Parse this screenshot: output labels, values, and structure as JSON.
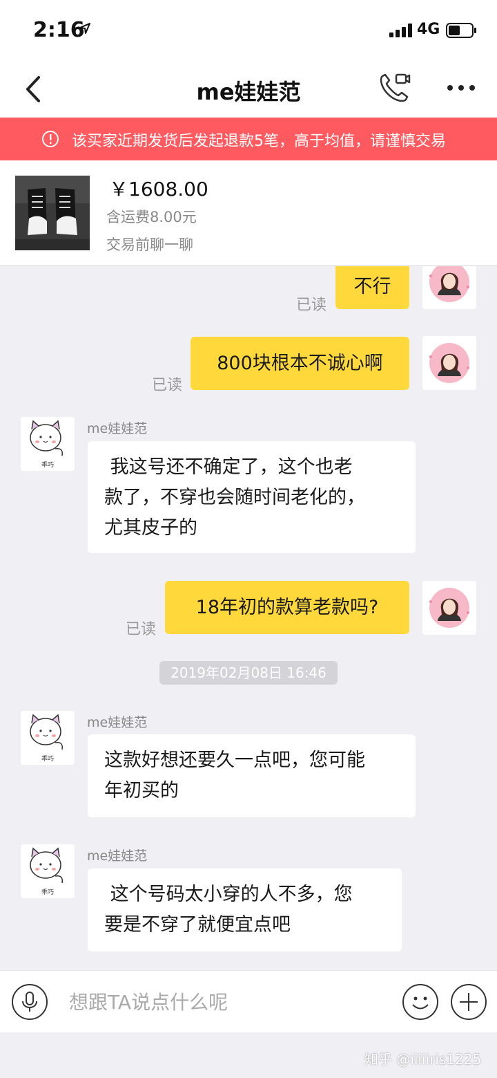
{
  "status_bar": {
    "time": "2:16",
    "network": "4G"
  },
  "header": {
    "title": "me娃娃范"
  },
  "warning": {
    "text": "该买家近期发货后发起退款5笔，高于均值，请谨慎交易"
  },
  "product": {
    "price": "￥1608.00",
    "shipping": "含运费8.00元",
    "hint": "交易前聊一聊"
  },
  "messages": [
    {
      "from": "me",
      "text": "不行",
      "status": "已读"
    },
    {
      "from": "me",
      "text": "800块根本不诚心啊",
      "status": "已读"
    },
    {
      "from": "them",
      "sender": "me娃娃范",
      "lines": [
        " 我这号还不确定了，这个也老",
        "款了，不穿也会随时间老化的，",
        "尤其皮子的"
      ]
    },
    {
      "from": "me",
      "text": "18年初的款算老款吗?",
      "status": "已读"
    },
    {
      "type": "time",
      "text": "2019年02月08日 16:46"
    },
    {
      "from": "them",
      "sender": "me娃娃范",
      "lines": [
        "这款好想还要久一点吧，您可能",
        "年初买的"
      ]
    },
    {
      "from": "them",
      "sender": "me娃娃范",
      "lines": [
        " 这个号码太小穿的人不多，您",
        "要是不穿了就便宜点吧"
      ]
    }
  ],
  "their_avatar_caption": "乖巧",
  "input": {
    "placeholder": "想跟TA说点什么呢"
  },
  "watermark": "知乎 @iiiiiris1225",
  "colors": {
    "warning": "#ff5a5f",
    "my_bubble": "#ffd93c",
    "background": "#efeff4"
  },
  "icons": [
    "location-arrow-icon",
    "signal-icon",
    "battery-icon",
    "back-icon",
    "video-call-icon",
    "more-icon",
    "warning-icon",
    "microphone-icon",
    "emoji-icon",
    "plus-icon"
  ]
}
